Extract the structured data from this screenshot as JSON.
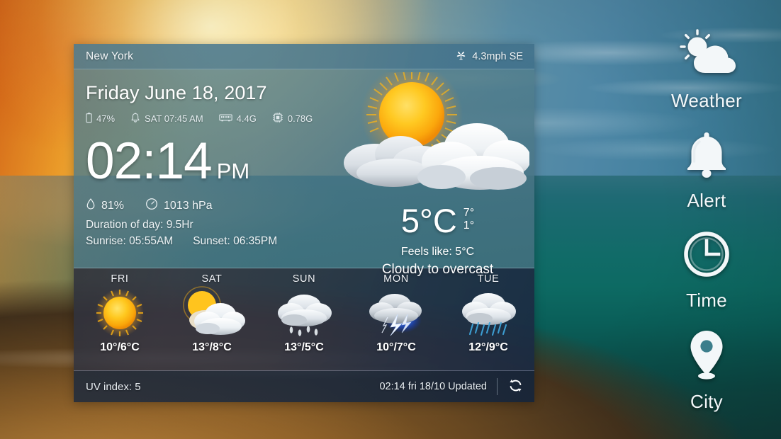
{
  "widget": {
    "header": {
      "city": "New York",
      "wind": "4.3mph SE",
      "wind_icon": "windmill-icon"
    },
    "date": "Friday June 18, 2017",
    "system": [
      {
        "icon": "battery-icon",
        "value": "47%"
      },
      {
        "icon": "alarm-bell-icon",
        "value": "SAT 07:45 AM"
      },
      {
        "icon": "ram-icon",
        "value": "4.4G"
      },
      {
        "icon": "cpu-icon",
        "value": "0.78G"
      }
    ],
    "clock": {
      "time": "02:14",
      "ampm": "PM"
    },
    "environment": [
      {
        "icon": "humidity-droplet-icon",
        "value": "81%"
      },
      {
        "icon": "barometer-icon",
        "value": "1013 hPa"
      }
    ],
    "duration_of_day": "Duration of day: 9.5Hr",
    "sunrise": "Sunrise: 05:55AM",
    "sunset": "Sunset: 06:35PM",
    "current": {
      "icon": "sun-behind-cloud-icon",
      "temperature": "5°C",
      "high": "7°",
      "low": "1°",
      "feels_like": "Feels like:  5°C",
      "condition": "Cloudy to overcast"
    },
    "forecast": [
      {
        "day": "FRI",
        "icon": "sunny-icon",
        "temp": "10°/6°C"
      },
      {
        "day": "SAT",
        "icon": "partly-cloudy-icon",
        "temp": "13°/8°C"
      },
      {
        "day": "SUN",
        "icon": "rain-icon",
        "temp": "13°/5°C"
      },
      {
        "day": "MON",
        "icon": "thunderstorm-icon",
        "temp": "10°/7°C"
      },
      {
        "day": "TUE",
        "icon": "showers-icon",
        "temp": "12°/9°C"
      }
    ],
    "footer": {
      "uv_index": "UV index: 5",
      "updated": "02:14 fri 18/10 Updated",
      "refresh_icon": "refresh-icon"
    }
  },
  "dock": {
    "items": [
      {
        "label": "Weather",
        "icon": "sun-cloud-icon"
      },
      {
        "label": "Alert",
        "icon": "bell-icon"
      },
      {
        "label": "Time",
        "icon": "clock-icon"
      },
      {
        "label": "City",
        "icon": "location-pin-icon"
      }
    ]
  },
  "colors": {
    "sun_yellow": "#FFC20E",
    "sun_orange": "#F2900D",
    "cloud_white": "#F4F6F8",
    "cloud_gray": "#B9BFC6",
    "rain_blue": "#39A9DC",
    "lightning_blue": "#1B5FD8",
    "accent_text": "#FFFFFF"
  }
}
